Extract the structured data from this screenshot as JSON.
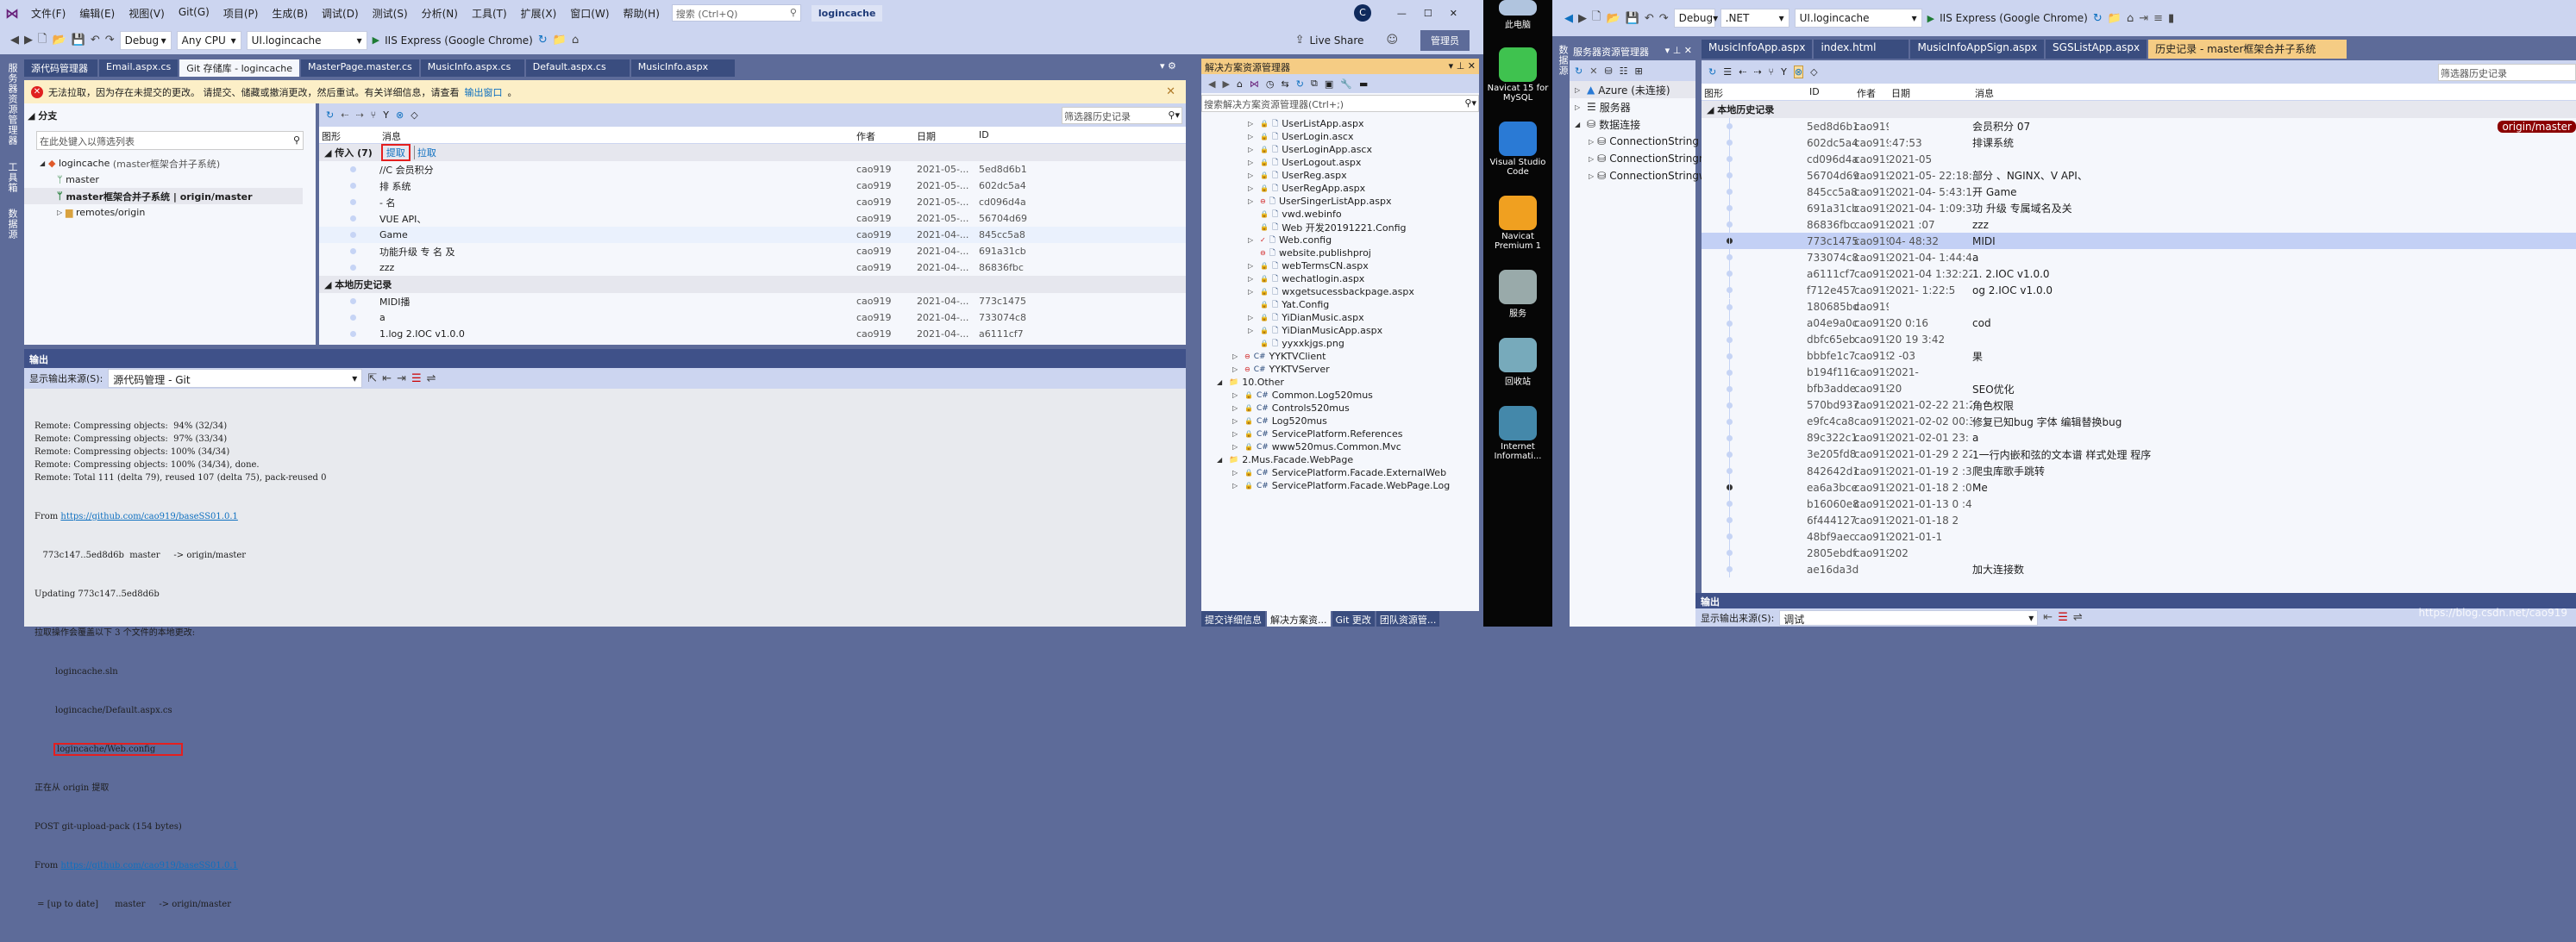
{
  "left_vs": {
    "menu": [
      "文件(F)",
      "编辑(E)",
      "视图(V)",
      "Git(G)",
      "项目(P)",
      "生成(B)",
      "调试(D)",
      "测试(S)",
      "分析(N)",
      "工具(T)",
      "扩展(X)",
      "窗口(W)",
      "帮助(H)"
    ],
    "search_placeholder": "搜索 (Ctrl+Q)",
    "solution_name": "logincache",
    "user_initial": "C",
    "live_share": "Live Share",
    "admin": "管理员",
    "config": "Debug",
    "platform": "Any CPU",
    "startup": "UI.logincache",
    "run": "IIS Express (Google Chrome)",
    "side_labels": [
      "服务器资源管理器",
      "工具箱",
      "数据源"
    ],
    "tabs": [
      "源代码管理器",
      "Email.aspx.cs",
      "Git 存储库 - logincache",
      "MasterPage.master.cs",
      "MusicInfo.aspx.cs",
      "Default.aspx.cs",
      "MusicInfo.aspx"
    ],
    "warning": {
      "text": "无法拉取，因为存在未提交的更改。 请提交、储藏或撤消更改，然后重试。有关详细信息，请查看",
      "link": "输出窗口",
      "suffix": "。"
    },
    "branches": {
      "title": "分支",
      "filter_placeholder": "在此处键入以筛选列表",
      "repo": "logincache",
      "repo_note": "(master框架合并子系统)",
      "items": [
        "master",
        "master框架合并子系统 | origin/master",
        "remotes/origin"
      ]
    },
    "history": {
      "filter_placeholder": "筛选器历史记录",
      "columns": [
        "图形",
        "消息",
        "作者",
        "日期",
        "ID"
      ],
      "incoming_label": "传入 (7)",
      "fetch": "提取",
      "pull": "拉取",
      "incoming": [
        {
          "msg": "//C  会员积分",
          "author": "cao919",
          "date": "2021-05-...",
          "id": "5ed8d6b1"
        },
        {
          "msg": "排  系统",
          "author": "cao919",
          "date": "2021-05-...",
          "id": "602dc5a4"
        },
        {
          "msg": "-   名",
          "author": "cao919",
          "date": "2021-05-...",
          "id": "cd096d4a"
        },
        {
          "msg": "     VUE API、",
          "author": "cao919",
          "date": "2021-05-...",
          "id": "56704d69"
        },
        {
          "msg": "   Game",
          "author": "cao919",
          "date": "2021-04-...",
          "id": "845cc5a8"
        },
        {
          "msg": "功能升级 专  名 及",
          "author": "cao919",
          "date": "2021-04-...",
          "id": "691a31cb"
        },
        {
          "msg": "zzz",
          "author": "cao919",
          "date": "2021-04-...",
          "id": "86836fbc"
        }
      ],
      "local_label": "本地历史记录",
      "local": [
        {
          "msg": "MIDI播",
          "author": "cao919",
          "date": "2021-04-...",
          "id": "773c1475"
        },
        {
          "msg": "a",
          "author": "cao919",
          "date": "2021-04-...",
          "id": "733074c8"
        },
        {
          "msg": "1.log   2.IOC v1.0.0",
          "author": "cao919",
          "date": "2021-04-...",
          "id": "a6111cf7"
        }
      ]
    },
    "output": {
      "title": "输出",
      "source_label": "显示输出来源(S):",
      "source": "源代码管理 - Git",
      "lines": [
        "Remote: Compressing objects:  94% (32/34)",
        "Remote: Compressing objects:  97% (33/34)",
        "Remote: Compressing objects: 100% (34/34)",
        "Remote: Compressing objects: 100% (34/34), done.",
        "Remote: Total 111 (delta 79), reused 107 (delta 75), pack-reused 0"
      ],
      "from_label": "From",
      "url": "https://github.com/cao919/baseSS01.0.1",
      "fetch_line": "   773c147..5ed8d6b  master     -> origin/master",
      "updating": "Updating 773c147..5ed8d6b",
      "overwrite": "拉取操作会覆盖以下 3 个文件的本地更改:",
      "files": [
        "logincache.sln",
        "logincache/Default.aspx.cs",
        "logincache/Web.config"
      ],
      "fetching": "正在从 origin 提取",
      "post": "POST git-upload-pack (154 bytes)",
      "uptodate": " = [up to date]      master     -> origin/master"
    }
  },
  "solution_explorer": {
    "title": "解决方案资源管理器",
    "search_placeholder": "搜索解决方案资源管理器(Ctrl+;)",
    "items": [
      {
        "name": "UserListApp.aspx",
        "lvl": 3,
        "exp": true,
        "st": "lock"
      },
      {
        "name": "UserLogin.ascx",
        "lvl": 3,
        "exp": true,
        "st": "lock"
      },
      {
        "name": "UserLoginApp.ascx",
        "lvl": 3,
        "exp": true,
        "st": "lock"
      },
      {
        "name": "UserLogout.aspx",
        "lvl": 3,
        "exp": true,
        "st": "lock"
      },
      {
        "name": "UserReg.aspx",
        "lvl": 3,
        "exp": true,
        "st": "lock"
      },
      {
        "name": "UserRegApp.aspx",
        "lvl": 3,
        "exp": true,
        "st": "lock"
      },
      {
        "name": "UserSingerListApp.aspx",
        "lvl": 3,
        "exp": true,
        "st": "add"
      },
      {
        "name": "vwd.webinfo",
        "lvl": 3,
        "exp": false,
        "st": "lock"
      },
      {
        "name": "Web 开发20191221.Config",
        "lvl": 3,
        "exp": false,
        "st": "lock"
      },
      {
        "name": "Web.config",
        "lvl": 3,
        "exp": true,
        "st": "mod"
      },
      {
        "name": "website.publishproj",
        "lvl": 3,
        "exp": false,
        "st": "add"
      },
      {
        "name": "webTermsCN.aspx",
        "lvl": 3,
        "exp": true,
        "st": "lock"
      },
      {
        "name": "wechatlogin.aspx",
        "lvl": 3,
        "exp": true,
        "st": "lock"
      },
      {
        "name": "wxgetsucessbackpage.aspx",
        "lvl": 3,
        "exp": true,
        "st": "lock"
      },
      {
        "name": "Yat.Config",
        "lvl": 3,
        "exp": false,
        "st": "lock"
      },
      {
        "name": "YiDianMusic.aspx",
        "lvl": 3,
        "exp": true,
        "st": "lock"
      },
      {
        "name": "YiDianMusicApp.aspx",
        "lvl": 3,
        "exp": true,
        "st": "lock"
      },
      {
        "name": "yyxxkjgs.png",
        "lvl": 3,
        "exp": false,
        "st": "lock"
      },
      {
        "name": "YYKTVClient",
        "lvl": 2,
        "exp": true,
        "st": "add"
      },
      {
        "name": "YYKTVServer",
        "lvl": 2,
        "exp": true,
        "st": "add"
      },
      {
        "name": "10.Other",
        "lvl": 1,
        "exp": true,
        "st": "folder"
      },
      {
        "name": "Common.Log520mus",
        "lvl": 2,
        "exp": true,
        "st": "lock"
      },
      {
        "name": "Controls520mus",
        "lvl": 2,
        "exp": true,
        "st": "lock"
      },
      {
        "name": "Log520mus",
        "lvl": 2,
        "exp": true,
        "st": "lock"
      },
      {
        "name": "ServicePlatform.References",
        "lvl": 2,
        "exp": true,
        "st": "lock"
      },
      {
        "name": "www520mus.Common.Mvc",
        "lvl": 2,
        "exp": true,
        "st": "lock"
      },
      {
        "name": "2.Mus.Facade.WebPage",
        "lvl": 1,
        "exp": true,
        "st": "folder"
      },
      {
        "name": "ServicePlatform.Facade.ExternalWeb",
        "lvl": 2,
        "exp": true,
        "st": "lock"
      },
      {
        "name": "ServicePlatform.Facade.WebPage.Log",
        "lvl": 2,
        "exp": true,
        "st": "lock"
      }
    ],
    "bottom_tabs": [
      "提交详细信息",
      "解决方案资...",
      "Git 更改",
      "团队资源管..."
    ]
  },
  "desktop": {
    "icons": [
      "此电脑",
      "Navicat 15 for MySQL",
      "Visual Studio Code",
      "Navicat Premium 1",
      "服务",
      "回收站",
      "Internet Informati..."
    ]
  },
  "right_vs": {
    "config": "Debug",
    "platform": ".NET",
    "startup": "UI.logincache",
    "run": "IIS Express (Google Chrome)",
    "side_label": "数据源",
    "server_explorer": {
      "title": "服务器资源管理器",
      "items": [
        {
          "name": "Azure (未连接)",
          "lvl": 0
        },
        {
          "name": "服务器",
          "lvl": 0
        },
        {
          "name": "数据连接",
          "lvl": 0
        },
        {
          "name": "ConnectionString (UI.l",
          "lvl": 1
        },
        {
          "name": "ConnectionStringread",
          "lvl": 1
        },
        {
          "name": "ConnectionStringworl",
          "lvl": 1
        }
      ]
    },
    "tabs": [
      "MusicInfoApp.aspx",
      "index.html",
      "MusicInfoAppSign.aspx",
      "SGSListApp.aspx",
      "历史记录 - master框架合并子系统"
    ],
    "filter_placeholder": "筛选器历史记录",
    "columns": [
      "图形",
      "ID",
      "作者",
      "日期",
      "消息"
    ],
    "group": "本地历史记录",
    "branch_badge": "origin/master",
    "rows": [
      {
        "id": "5ed8d6b1",
        "a": "cao919",
        "d": "",
        "m": "会员积分 07"
      },
      {
        "id": "602dc5a4",
        "a": "cao919",
        "d": "  :47:53",
        "m": "排课系统"
      },
      {
        "id": "cd096d4a",
        "a": "cao919",
        "d": "2021-05",
        "m": ""
      },
      {
        "id": "56704d69",
        "a": "cao919",
        "d": "2021-05-  22:18:20",
        "m": "部分  、NGINX、V   API、"
      },
      {
        "id": "845cc5a8",
        "a": "cao919",
        "d": "2021-04-   5:43:12",
        "m": "开  Game"
      },
      {
        "id": "691a31cb",
        "a": "cao919",
        "d": "2021-04-  1:09:34",
        "m": "功  升级 专属域名及关"
      },
      {
        "id": "86836fbc",
        "a": "cao919",
        "d": "2021    :07",
        "m": "zzz"
      },
      {
        "id": "773c1475",
        "a": "cao919",
        "d": "  04-   48:32",
        "m": "MIDI"
      },
      {
        "id": "733074c8",
        "a": "cao919",
        "d": "2021-04-  1:44:44",
        "m": "a"
      },
      {
        "id": "a6111cf7",
        "a": "cao919",
        "d": "2021-04   1:32:22",
        "m": "1.   2.IOC v1.0.0"
      },
      {
        "id": "f712e457",
        "a": "cao919",
        "d": "2021-    1:22:5",
        "m": "  og  2.IOC v1.0.0"
      },
      {
        "id": "180685bd",
        "a": "cao919",
        "d": "",
        "m": ""
      },
      {
        "id": "a04e9a0c",
        "a": "cao919",
        "d": "20     0:16",
        "m": "cod"
      },
      {
        "id": "dbfc65eb",
        "a": "cao919",
        "d": "20   19  3:42",
        "m": ""
      },
      {
        "id": "bbbfe1c7",
        "a": "cao919",
        "d": "2  -03",
        "m": "  果"
      },
      {
        "id": "b194f116",
        "a": "cao919",
        "d": "2021-",
        "m": ""
      },
      {
        "id": "bfb3adde",
        "a": "cao919",
        "d": "20",
        "m": "SEO优化"
      },
      {
        "id": "570bd937",
        "a": "cao919",
        "d": "2021-02-22 21:24",
        "m": "角色权限"
      },
      {
        "id": "e9fc4ca8",
        "a": "cao919",
        "d": "2021-02-02 00:3",
        "m": "修复已知bug 字体 编辑替换bug"
      },
      {
        "id": "89c322c1",
        "a": "cao919",
        "d": "2021-02-01 23:  7",
        "m": "a"
      },
      {
        "id": "3e205fd8",
        "a": "cao919",
        "d": "2021-01-29 2   22",
        "m": "1一行内嵌和弦的文本谱 样式处理 程序"
      },
      {
        "id": "842642d1",
        "a": "cao919",
        "d": "2021-01-19 2   :36",
        "m": "爬虫库歌手跳转"
      },
      {
        "id": "ea6a3bce",
        "a": "cao919",
        "d": "2021-01-18 2   :09",
        "m": "Me"
      },
      {
        "id": "b16060e8",
        "a": "cao919",
        "d": "2021-01-13 0   :46",
        "m": ""
      },
      {
        "id": "6f444127",
        "a": "cao919",
        "d": "2021-01-18 2",
        "m": ""
      },
      {
        "id": "48bf9aec",
        "a": "cao919",
        "d": "2021-01-1",
        "m": ""
      },
      {
        "id": "2805ebdf",
        "a": "cao919",
        "d": "202",
        "m": ""
      },
      {
        "id": "ae16da3d",
        "a": "",
        "d": "",
        "m": "加大连接数"
      }
    ],
    "selected_id": "773c1475",
    "output": {
      "title": "输出",
      "source_label": "显示输出来源(S):",
      "source": "调试"
    },
    "watermark": "https://blog.csdn.net/cao919"
  },
  "colors": {
    "chrome": "#ccd5f0",
    "frame": "#5d6b99",
    "tab": "#3a4d7f",
    "accent_tab": "#f5cc84",
    "warning": "#fcefc7",
    "error": "#e02020",
    "link": "#0e70c0",
    "badge": "#8b0000",
    "highlight": "#e41f1f"
  }
}
